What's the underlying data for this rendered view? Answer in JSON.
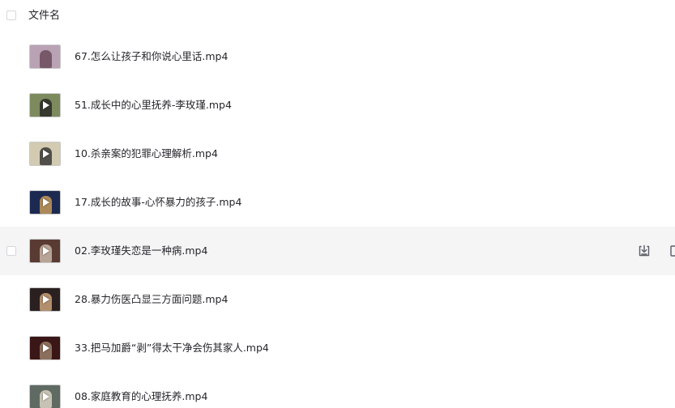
{
  "header": {
    "column_label": "文件名"
  },
  "files": [
    {
      "name": "67.怎么让孩子和你说心里话.mp4",
      "thumb_bg": "#b9a2b4",
      "thumb_fig": "#6b4b5a",
      "play": false
    },
    {
      "name": "51.成长中的心里抚养-李玫瑾.mp4",
      "thumb_bg": "#7d8a5e",
      "thumb_fig": "#2a2a26",
      "play": true
    },
    {
      "name": "10.杀亲案的犯罪心理解析.mp4",
      "thumb_bg": "#d2cbb2",
      "thumb_fig": "#3b3a36",
      "play": true
    },
    {
      "name": "17.成长的故事-心怀暴力的孩子.mp4",
      "thumb_bg": "#1c2a52",
      "thumb_fig": "#c59a5a",
      "play": true
    },
    {
      "name": "02.李玫瑾失恋是一种病.mp4",
      "thumb_bg": "#5a3b33",
      "thumb_fig": "#c9b7a8",
      "play": true
    },
    {
      "name": "28.暴力伤医凸显三方面问题.mp4",
      "thumb_bg": "#2b2020",
      "thumb_fig": "#caa27a",
      "play": true
    },
    {
      "name": "33.把马加爵“剥”得太干净会伤其家人.mp4",
      "thumb_bg": "#3a1616",
      "thumb_fig": "#9a7f6a",
      "play": true
    },
    {
      "name": "08.家庭教育的心理抚养.mp4",
      "thumb_bg": "#5f6a63",
      "thumb_fig": "#d9d2c2",
      "play": true
    }
  ],
  "hovered_row_index": 4,
  "row_actions": {
    "download_icon": "download-icon",
    "copy_icon": "copy-icon"
  }
}
